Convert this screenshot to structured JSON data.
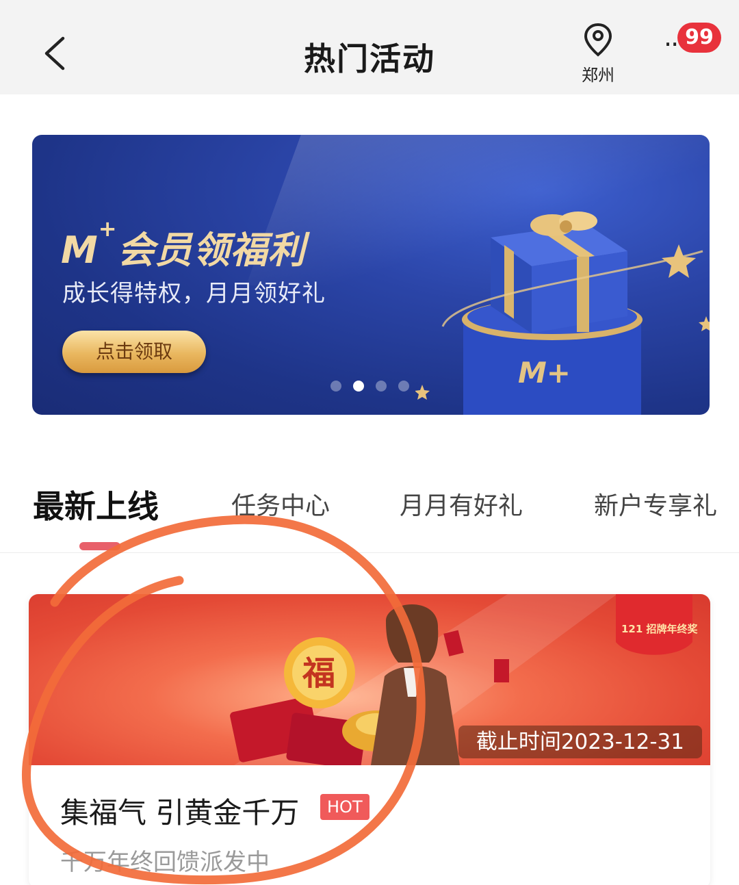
{
  "header": {
    "title": "热门活动",
    "location": "郑州",
    "more_label": "···",
    "badge_count": "99"
  },
  "banner": {
    "title_main": "M",
    "title_sup": "+",
    "title_rest": "会员领福利",
    "subtitle": "成长得特权，月月领好礼",
    "cta_label": "点击领取",
    "logo_text": "M+",
    "carousel_total": 4,
    "carousel_active": 2
  },
  "tabs": [
    {
      "label": "最新上线",
      "active": true
    },
    {
      "label": "任务中心",
      "active": false
    },
    {
      "label": "月月有好礼",
      "active": false
    },
    {
      "label": "新户专享礼",
      "active": false
    }
  ],
  "card": {
    "deadline": "截止时间2023-12-31",
    "title": "集福气 引黄金千万",
    "hot_label": "HOT",
    "subtitle": "千万年终回馈派发中",
    "coin_text": "福",
    "tag_text": "121 招牌年终奖"
  },
  "colors": {
    "accent_red": "#e8323c",
    "banner_blue": "#2b45a8",
    "gold": "#e9b75f",
    "annotation_orange": "#f26b3a"
  }
}
